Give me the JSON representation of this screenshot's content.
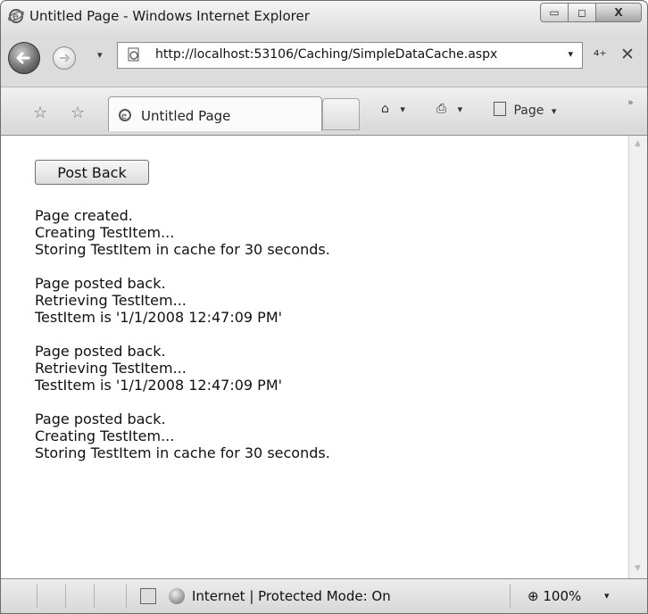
{
  "window": {
    "title": "Untitled Page - Windows Internet Explorer",
    "minimize_glyph": "▭",
    "maximize_glyph": "◻",
    "close_glyph": "X"
  },
  "navigation": {
    "url": "http://localhost:53106/Caching/SimpleDataCache.aspx",
    "dropdown_glyph": "▾",
    "refresh_glyph": "⁴⁺",
    "stop_glyph": "✕"
  },
  "tabbar": {
    "tab_label": "Untitled Page",
    "home_glyph": "⌂",
    "print_glyph": "⎙",
    "page_menu_label": "Page",
    "menu_arrow": "▾",
    "overflow_glyph": "»",
    "favorites_star": "☆",
    "add_favorites": "☆"
  },
  "page": {
    "button_label": "Post Back",
    "log_groups": [
      [
        "Page created.",
        "Creating TestItem...",
        "Storing TestItem in cache for 30 seconds."
      ],
      [
        "Page posted back.",
        "Retrieving TestItem...",
        "TestItem is '1/1/2008 12:47:09 PM'"
      ],
      [
        "Page posted back.",
        "Retrieving TestItem...",
        "TestItem is '1/1/2008 12:47:09 PM'"
      ],
      [
        "Page posted back.",
        "Creating TestItem...",
        "Storing TestItem in cache for 30 seconds."
      ]
    ]
  },
  "statusbar": {
    "zone_text": "Internet | Protected Mode: On",
    "zoom": "100%",
    "zoom_glyph": "⊕",
    "zoom_dropdown": "▾"
  },
  "icons": {
    "ie_logo": "ie-logo-icon",
    "back": "back-arrow-icon",
    "forward": "forward-arrow-icon",
    "page": "page-icon",
    "home": "home-icon",
    "print": "print-icon",
    "globe": "globe-icon"
  }
}
